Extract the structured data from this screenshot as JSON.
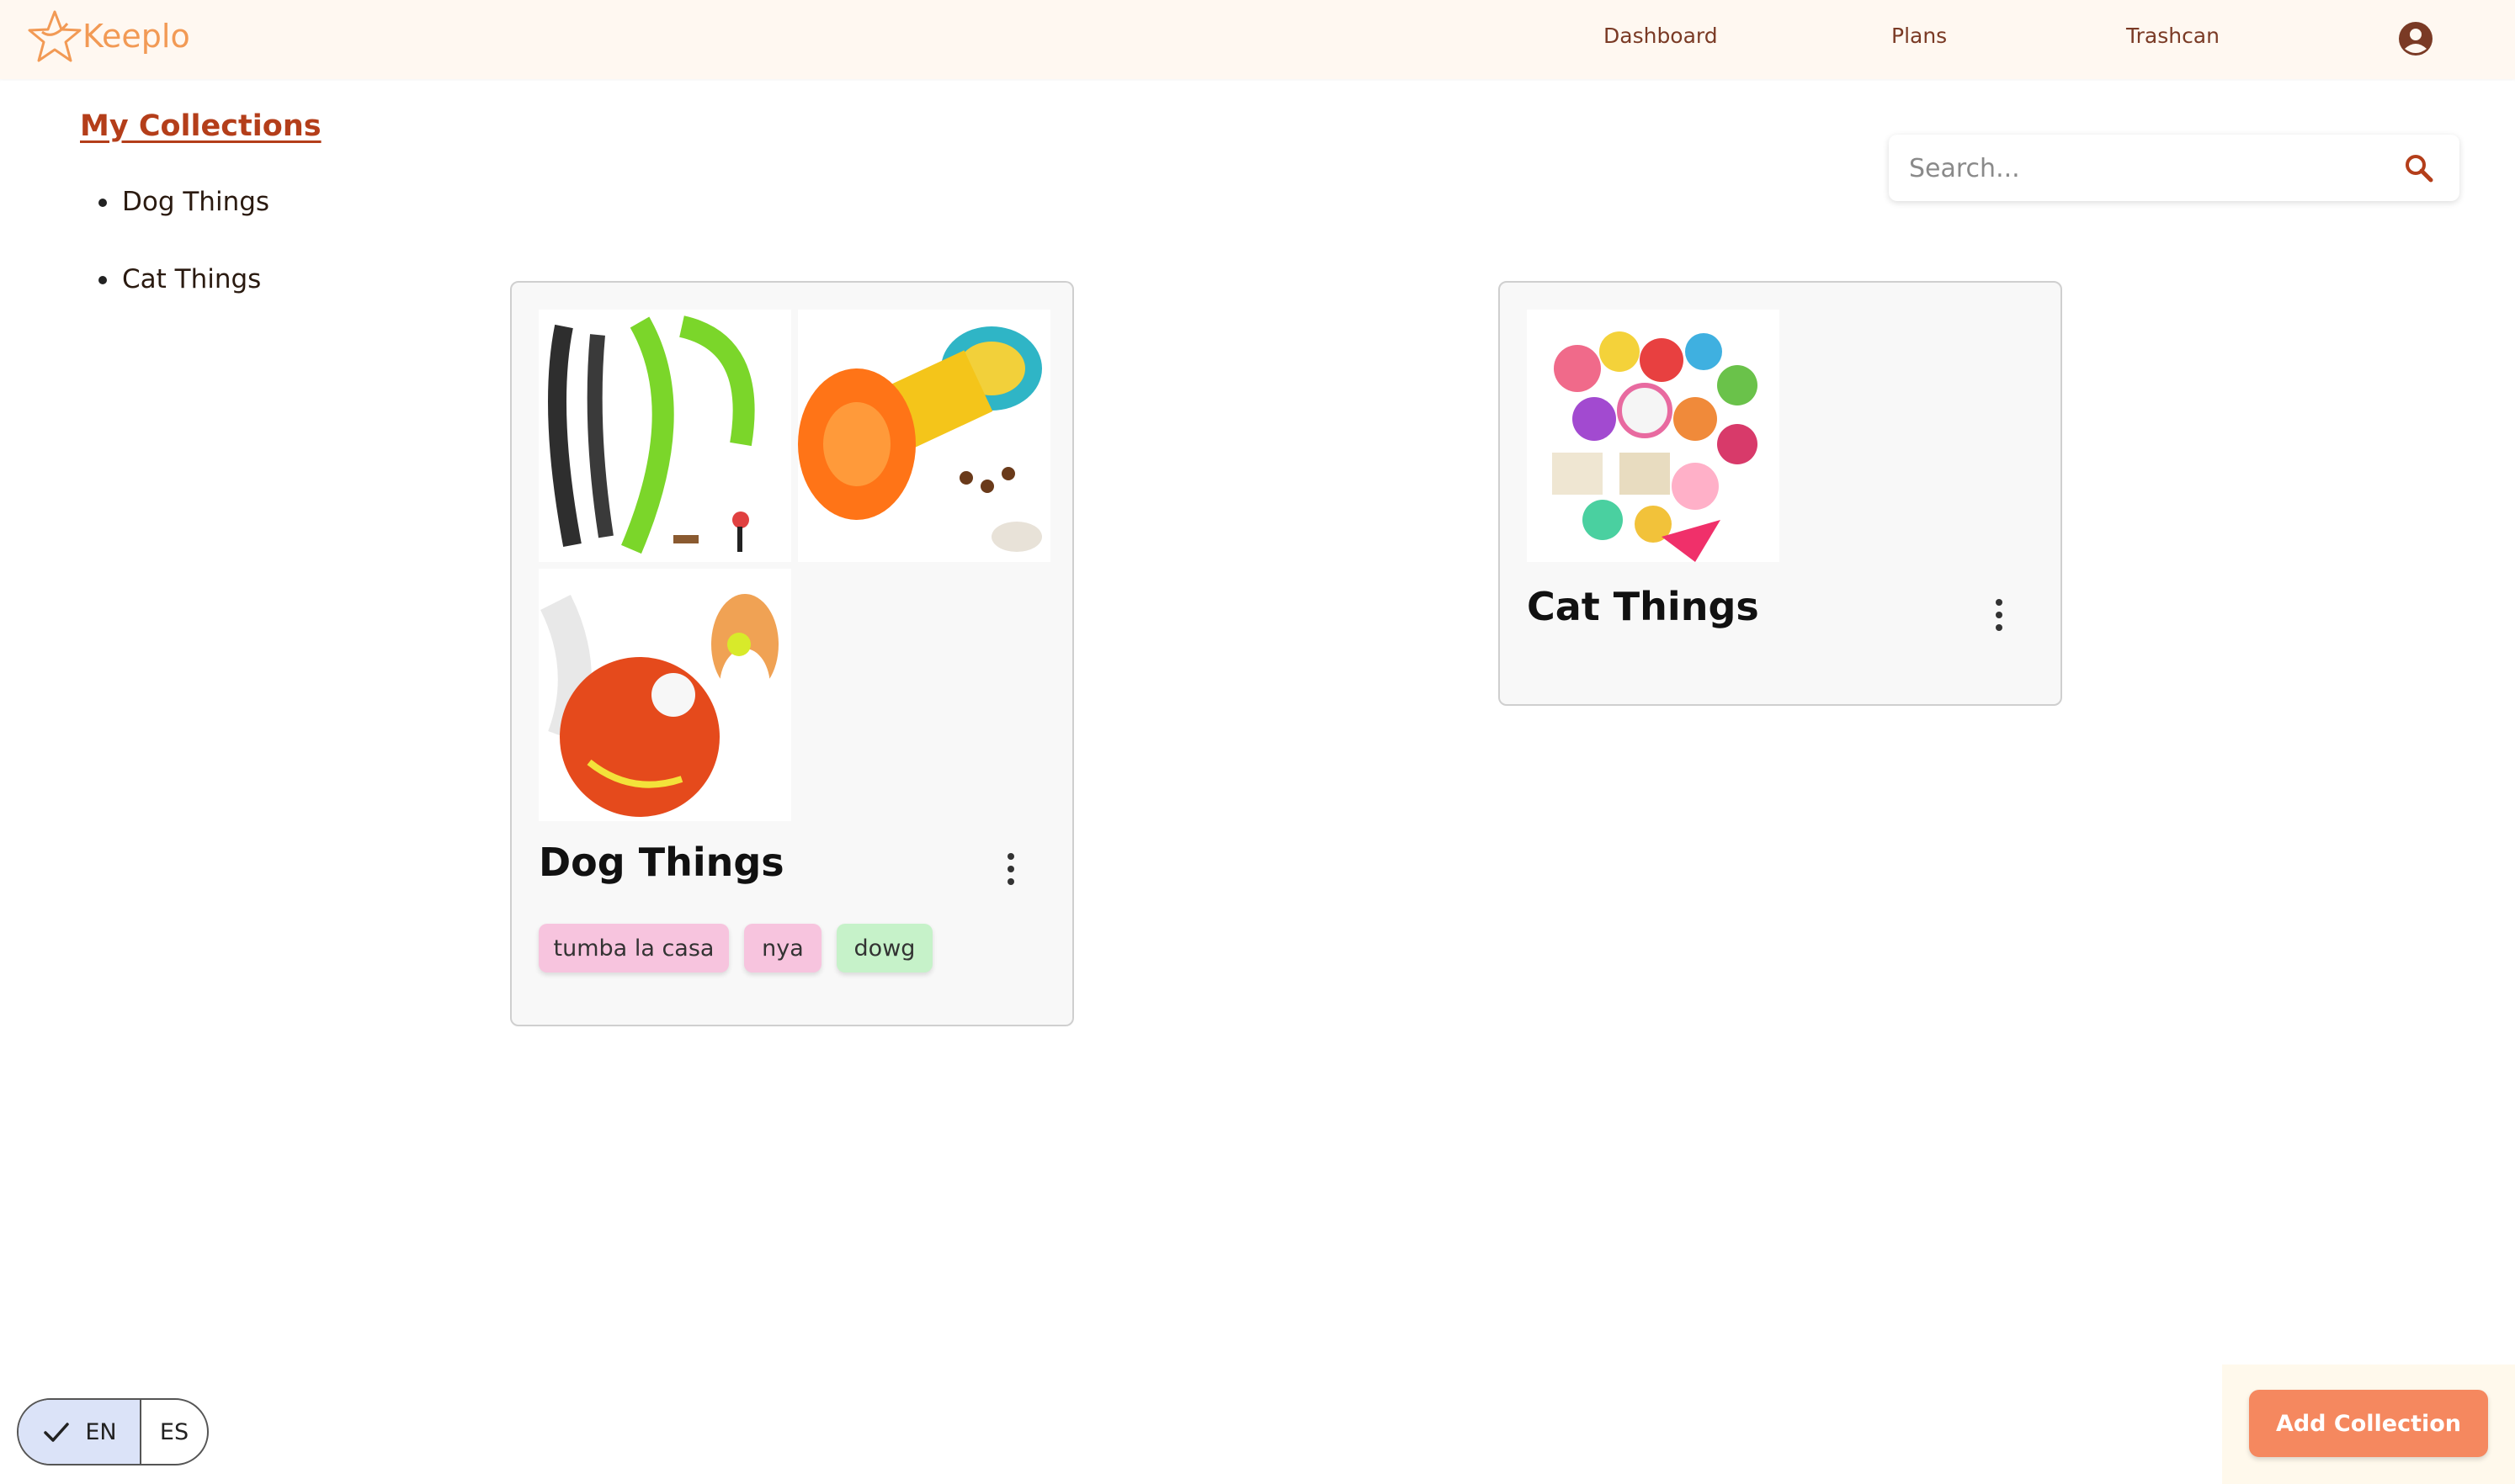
{
  "app": {
    "name": "Keeplo",
    "brand_color": "#f29a55",
    "accent_color": "#b43e1a"
  },
  "nav": {
    "links": [
      {
        "label": "Dashboard"
      },
      {
        "label": "Plans"
      },
      {
        "label": "Trashcan"
      }
    ]
  },
  "sidebar": {
    "title": "My Collections",
    "items": [
      {
        "label": "Dog Things"
      },
      {
        "label": "Cat Things"
      }
    ]
  },
  "search": {
    "placeholder": "Search...",
    "value": ""
  },
  "collections": [
    {
      "title": "Dog Things",
      "images": [
        "dog-leash-photo",
        "treat-dispenser-toy-photo",
        "orange-ball-toy-with-corgi-photo"
      ],
      "tags": [
        {
          "label": "tumba la casa",
          "color": "#f7c4de"
        },
        {
          "label": "nya",
          "color": "#f7c4de"
        },
        {
          "label": "dowg",
          "color": "#c6f2c9"
        }
      ]
    },
    {
      "title": "Cat Things",
      "images": [
        "assorted-cat-toys-photo"
      ],
      "tags": []
    }
  ],
  "language": {
    "options": [
      "EN",
      "ES"
    ],
    "selected": "EN"
  },
  "actions": {
    "add_collection": "Add Collection"
  }
}
